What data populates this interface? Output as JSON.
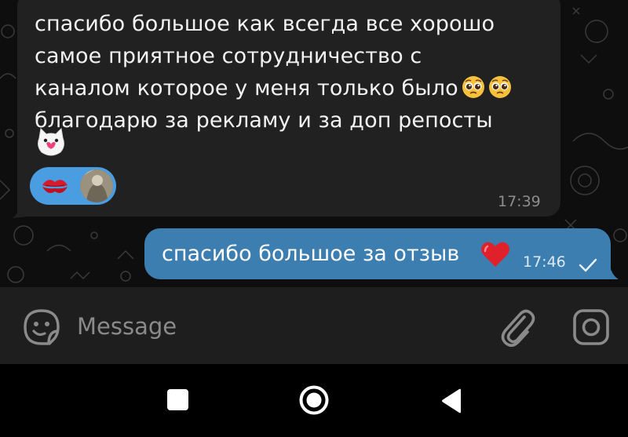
{
  "conversation": {
    "incoming": {
      "text_lines": [
        "спасибо большое как всегда все хорошо",
        "самое приятное сотрудничество с",
        "каналом которое у меня только было",
        "благодарю за рекламу и за доп репосты"
      ],
      "emoji_after_line_3": [
        "pleading-face",
        "pleading-face"
      ],
      "sticker": "cat-with-heart-sticker",
      "reactions": [
        "kiss-mark",
        "user-avatar"
      ],
      "time": "17:39"
    },
    "outgoing": {
      "text": "спасибо большое за отзыв",
      "emoji": "red-heart",
      "time": "17:46",
      "status": "sent-check"
    }
  },
  "composer": {
    "placeholder": "Message",
    "icons": [
      "emoji-icon",
      "attach-icon",
      "camera-icon"
    ]
  },
  "system_nav": {
    "icons": [
      "recents-icon",
      "home-icon",
      "back-icon"
    ]
  },
  "colors": {
    "chat_background": "#0e0e0e",
    "incoming_bubble": "#212121",
    "outgoing_bubble": "#3d7eb0",
    "reaction_pill": "#4a9de0",
    "composer_background": "#1e1e1e"
  }
}
